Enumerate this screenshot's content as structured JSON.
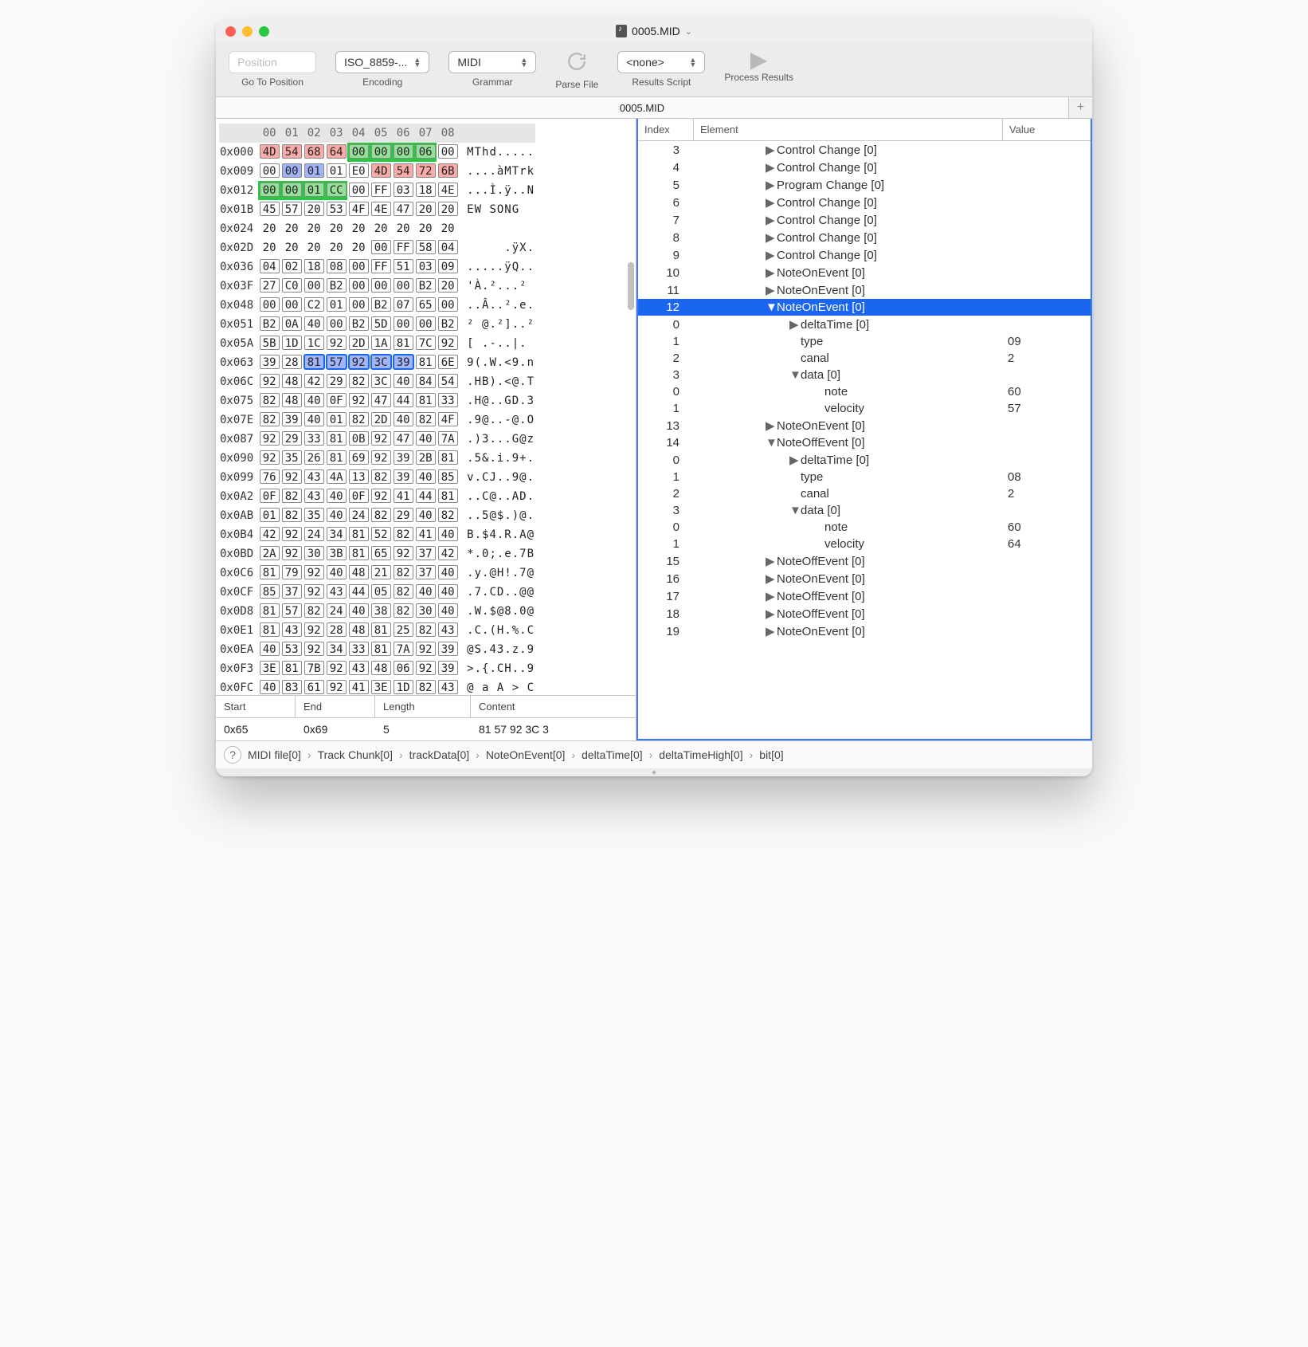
{
  "title": "0005.MID",
  "traffic": {
    "red": "close",
    "yellow": "minimize",
    "green": "zoom"
  },
  "toolbar": {
    "position": {
      "placeholder": "Position",
      "label": "Go To Position"
    },
    "encoding": {
      "value": "ISO_8859-...",
      "label": "Encoding"
    },
    "grammar": {
      "value": "MIDI",
      "label": "Grammar"
    },
    "parse": {
      "label": "Parse File"
    },
    "results": {
      "value": "<none>",
      "label": "Results Script"
    },
    "process": {
      "label": "Process Results"
    }
  },
  "tab": {
    "name": "0005.MID",
    "add": "+"
  },
  "hex": {
    "cols": [
      "00",
      "01",
      "02",
      "03",
      "04",
      "05",
      "06",
      "07",
      "08"
    ],
    "rows": [
      {
        "addr": "0x000",
        "bytes": [
          "4D",
          "54",
          "68",
          "64",
          "00",
          "00",
          "00",
          "06",
          "00"
        ],
        "ascii": "MThd.....",
        "styles": [
          "pink",
          "pink",
          "pink",
          "pink",
          "green",
          "green",
          "green",
          "green",
          "box-only"
        ]
      },
      {
        "addr": "0x009",
        "bytes": [
          "00",
          "00",
          "01",
          "01",
          "E0",
          "4D",
          "54",
          "72",
          "6B"
        ],
        "ascii": "....àMTrk",
        "styles": [
          "box-only",
          "blue",
          "blue",
          "box-only",
          "box-only",
          "pink",
          "pink",
          "pink",
          "pink"
        ]
      },
      {
        "addr": "0x012",
        "bytes": [
          "00",
          "00",
          "01",
          "CC",
          "00",
          "FF",
          "03",
          "18",
          "4E"
        ],
        "ascii": "...Ì.ÿ..N",
        "styles": [
          "green",
          "green",
          "green",
          "green",
          "box-only",
          "box-only",
          "box-only",
          "box-only",
          "box-only"
        ]
      },
      {
        "addr": "0x01B",
        "bytes": [
          "45",
          "57",
          "20",
          "53",
          "4F",
          "4E",
          "47",
          "20",
          "20"
        ],
        "ascii": "EW SONG",
        "styles": [
          "box-only",
          "box-only",
          "box-only",
          "box-only",
          "box-only",
          "box-only",
          "box-only",
          "box-only",
          "box-only"
        ]
      },
      {
        "addr": "0x024",
        "bytes": [
          "20",
          "20",
          "20",
          "20",
          "20",
          "20",
          "20",
          "20",
          "20"
        ],
        "ascii": "",
        "styles": [
          "",
          "",
          "",
          "",
          "",
          "",
          "",
          "",
          ""
        ]
      },
      {
        "addr": "0x02D",
        "bytes": [
          "20",
          "20",
          "20",
          "20",
          "20",
          "00",
          "FF",
          "58",
          "04"
        ],
        "ascii": "     .ÿX.",
        "styles": [
          "",
          "",
          "",
          "",
          "",
          "box-only",
          "box-only",
          "box-only",
          "box-only"
        ]
      },
      {
        "addr": "0x036",
        "bytes": [
          "04",
          "02",
          "18",
          "08",
          "00",
          "FF",
          "51",
          "03",
          "09"
        ],
        "ascii": ".....ÿQ..",
        "styles": [
          "box-only",
          "box-only",
          "box-only",
          "box-only",
          "box-only",
          "box-only",
          "box-only",
          "box-only",
          "box-only"
        ]
      },
      {
        "addr": "0x03F",
        "bytes": [
          "27",
          "C0",
          "00",
          "B2",
          "00",
          "00",
          "00",
          "B2",
          "20"
        ],
        "ascii": "'À.²...² ",
        "styles": [
          "box-only",
          "box-only",
          "box-only",
          "box-only",
          "box-only",
          "box-only",
          "box-only",
          "box-only",
          "box-only"
        ]
      },
      {
        "addr": "0x048",
        "bytes": [
          "00",
          "00",
          "C2",
          "01",
          "00",
          "B2",
          "07",
          "65",
          "00"
        ],
        "ascii": "..Â..².e.",
        "styles": [
          "box-only",
          "box-only",
          "box-only",
          "box-only",
          "box-only",
          "box-only",
          "box-only",
          "box-only",
          "box-only"
        ]
      },
      {
        "addr": "0x051",
        "bytes": [
          "B2",
          "0A",
          "40",
          "00",
          "B2",
          "5D",
          "00",
          "00",
          "B2"
        ],
        "ascii": "² @.²]..²",
        "styles": [
          "box-only",
          "box-only",
          "box-only",
          "box-only",
          "box-only",
          "box-only",
          "box-only",
          "box-only",
          "box-only"
        ]
      },
      {
        "addr": "0x05A",
        "bytes": [
          "5B",
          "1D",
          "1C",
          "92",
          "2D",
          "1A",
          "81",
          "7C",
          "92"
        ],
        "ascii": "[ .-..|.",
        "styles": [
          "box-only",
          "box-only",
          "box-only",
          "box-only",
          "box-only",
          "box-only",
          "box-only",
          "box-only",
          "box-only"
        ]
      },
      {
        "addr": "0x063",
        "bytes": [
          "39",
          "28",
          "81",
          "57",
          "92",
          "3C",
          "39",
          "81",
          "6E"
        ],
        "ascii": "9(.W.<9.n",
        "styles": [
          "box-only",
          "box-only",
          "sel",
          "sel",
          "sel",
          "sel",
          "sel",
          "box-only",
          "box-only"
        ]
      },
      {
        "addr": "0x06C",
        "bytes": [
          "92",
          "48",
          "42",
          "29",
          "82",
          "3C",
          "40",
          "84",
          "54"
        ],
        "ascii": ".HB).<@.T",
        "styles": [
          "box-only",
          "box-only",
          "box-only",
          "box-only",
          "box-only",
          "box-only",
          "box-only",
          "box-only",
          "box-only"
        ]
      },
      {
        "addr": "0x075",
        "bytes": [
          "82",
          "48",
          "40",
          "0F",
          "92",
          "47",
          "44",
          "81",
          "33"
        ],
        "ascii": ".H@..GD.3",
        "styles": [
          "box-only",
          "box-only",
          "box-only",
          "box-only",
          "box-only",
          "box-only",
          "box-only",
          "box-only",
          "box-only"
        ]
      },
      {
        "addr": "0x07E",
        "bytes": [
          "82",
          "39",
          "40",
          "01",
          "82",
          "2D",
          "40",
          "82",
          "4F"
        ],
        "ascii": ".9@..-@.O",
        "styles": [
          "box-only",
          "box-only",
          "box-only",
          "box-only",
          "box-only",
          "box-only",
          "box-only",
          "box-only",
          "box-only"
        ]
      },
      {
        "addr": "0x087",
        "bytes": [
          "92",
          "29",
          "33",
          "81",
          "0B",
          "92",
          "47",
          "40",
          "7A"
        ],
        "ascii": ".)3...G@z",
        "styles": [
          "box-only",
          "box-only",
          "box-only",
          "box-only",
          "box-only",
          "box-only",
          "box-only",
          "box-only",
          "box-only"
        ]
      },
      {
        "addr": "0x090",
        "bytes": [
          "92",
          "35",
          "26",
          "81",
          "69",
          "92",
          "39",
          "2B",
          "81"
        ],
        "ascii": ".5&.i.9+.",
        "styles": [
          "box-only",
          "box-only",
          "box-only",
          "box-only",
          "box-only",
          "box-only",
          "box-only",
          "box-only",
          "box-only"
        ]
      },
      {
        "addr": "0x099",
        "bytes": [
          "76",
          "92",
          "43",
          "4A",
          "13",
          "82",
          "39",
          "40",
          "85"
        ],
        "ascii": "v.CJ..9@.",
        "styles": [
          "box-only",
          "box-only",
          "box-only",
          "box-only",
          "box-only",
          "box-only",
          "box-only",
          "box-only",
          "box-only"
        ]
      },
      {
        "addr": "0x0A2",
        "bytes": [
          "0F",
          "82",
          "43",
          "40",
          "0F",
          "92",
          "41",
          "44",
          "81"
        ],
        "ascii": "..C@..AD.",
        "styles": [
          "box-only",
          "box-only",
          "box-only",
          "box-only",
          "box-only",
          "box-only",
          "box-only",
          "box-only",
          "box-only"
        ]
      },
      {
        "addr": "0x0AB",
        "bytes": [
          "01",
          "82",
          "35",
          "40",
          "24",
          "82",
          "29",
          "40",
          "82"
        ],
        "ascii": "..5@$.)@.",
        "styles": [
          "box-only",
          "box-only",
          "box-only",
          "box-only",
          "box-only",
          "box-only",
          "box-only",
          "box-only",
          "box-only"
        ]
      },
      {
        "addr": "0x0B4",
        "bytes": [
          "42",
          "92",
          "24",
          "34",
          "81",
          "52",
          "82",
          "41",
          "40"
        ],
        "ascii": "B.$4.R.A@",
        "styles": [
          "box-only",
          "box-only",
          "box-only",
          "box-only",
          "box-only",
          "box-only",
          "box-only",
          "box-only",
          "box-only"
        ]
      },
      {
        "addr": "0x0BD",
        "bytes": [
          "2A",
          "92",
          "30",
          "3B",
          "81",
          "65",
          "92",
          "37",
          "42"
        ],
        "ascii": "*.0;.e.7B",
        "styles": [
          "box-only",
          "box-only",
          "box-only",
          "box-only",
          "box-only",
          "box-only",
          "box-only",
          "box-only",
          "box-only"
        ]
      },
      {
        "addr": "0x0C6",
        "bytes": [
          "81",
          "79",
          "92",
          "40",
          "48",
          "21",
          "82",
          "37",
          "40"
        ],
        "ascii": ".y.@H!.7@",
        "styles": [
          "box-only",
          "box-only",
          "box-only",
          "box-only",
          "box-only",
          "box-only",
          "box-only",
          "box-only",
          "box-only"
        ]
      },
      {
        "addr": "0x0CF",
        "bytes": [
          "85",
          "37",
          "92",
          "43",
          "44",
          "05",
          "82",
          "40",
          "40"
        ],
        "ascii": ".7.CD..@@",
        "styles": [
          "box-only",
          "box-only",
          "box-only",
          "box-only",
          "box-only",
          "box-only",
          "box-only",
          "box-only",
          "box-only"
        ]
      },
      {
        "addr": "0x0D8",
        "bytes": [
          "81",
          "57",
          "82",
          "24",
          "40",
          "38",
          "82",
          "30",
          "40"
        ],
        "ascii": ".W.$@8.0@",
        "styles": [
          "box-only",
          "box-only",
          "box-only",
          "box-only",
          "box-only",
          "box-only",
          "box-only",
          "box-only",
          "box-only"
        ]
      },
      {
        "addr": "0x0E1",
        "bytes": [
          "81",
          "43",
          "92",
          "28",
          "48",
          "81",
          "25",
          "82",
          "43"
        ],
        "ascii": ".C.(H.%.C",
        "styles": [
          "box-only",
          "box-only",
          "box-only",
          "box-only",
          "box-only",
          "box-only",
          "box-only",
          "box-only",
          "box-only"
        ]
      },
      {
        "addr": "0x0EA",
        "bytes": [
          "40",
          "53",
          "92",
          "34",
          "33",
          "81",
          "7A",
          "92",
          "39"
        ],
        "ascii": "@S.43.z.9",
        "styles": [
          "box-only",
          "box-only",
          "box-only",
          "box-only",
          "box-only",
          "box-only",
          "box-only",
          "box-only",
          "box-only"
        ]
      },
      {
        "addr": "0x0F3",
        "bytes": [
          "3E",
          "81",
          "7B",
          "92",
          "43",
          "48",
          "06",
          "92",
          "39"
        ],
        "ascii": ">.{.CH..9",
        "styles": [
          "box-only",
          "box-only",
          "box-only",
          "box-only",
          "box-only",
          "box-only",
          "box-only",
          "box-only",
          "box-only"
        ]
      },
      {
        "addr": "0x0FC",
        "bytes": [
          "40",
          "83",
          "61",
          "92",
          "41",
          "3E",
          "1D",
          "82",
          "43"
        ],
        "ascii": "@ a A > C",
        "styles": [
          "box-only",
          "box-only",
          "box-only",
          "box-only",
          "box-only",
          "box-only",
          "box-only",
          "box-only",
          "box-only"
        ]
      }
    ],
    "info_head": {
      "start": "Start",
      "end": "End",
      "length": "Length",
      "content": "Content"
    },
    "info": {
      "start": "0x65",
      "end": "0x69",
      "length": "5",
      "content": "81 57 92 3C 3"
    }
  },
  "tree": {
    "head": {
      "index": "Index",
      "element": "Element",
      "value": "Value"
    },
    "rows": [
      {
        "idx": "3",
        "indent": 1,
        "caret": "▶",
        "label": "Control Change [0]",
        "val": ""
      },
      {
        "idx": "4",
        "indent": 1,
        "caret": "▶",
        "label": "Control Change [0]",
        "val": ""
      },
      {
        "idx": "5",
        "indent": 1,
        "caret": "▶",
        "label": "Program Change [0]",
        "val": ""
      },
      {
        "idx": "6",
        "indent": 1,
        "caret": "▶",
        "label": "Control Change [0]",
        "val": ""
      },
      {
        "idx": "7",
        "indent": 1,
        "caret": "▶",
        "label": "Control Change [0]",
        "val": ""
      },
      {
        "idx": "8",
        "indent": 1,
        "caret": "▶",
        "label": "Control Change [0]",
        "val": ""
      },
      {
        "idx": "9",
        "indent": 1,
        "caret": "▶",
        "label": "Control Change [0]",
        "val": ""
      },
      {
        "idx": "10",
        "indent": 1,
        "caret": "▶",
        "label": "NoteOnEvent [0]",
        "val": ""
      },
      {
        "idx": "11",
        "indent": 1,
        "caret": "▶",
        "label": "NoteOnEvent [0]",
        "val": ""
      },
      {
        "idx": "12",
        "indent": 1,
        "caret": "▼",
        "label": "NoteOnEvent [0]",
        "val": "",
        "sel": true
      },
      {
        "idx": "0",
        "indent": 2,
        "caret": "▶",
        "label": "deltaTime [0]",
        "val": ""
      },
      {
        "idx": "1",
        "indent": 2,
        "caret": "",
        "label": "type",
        "val": "09"
      },
      {
        "idx": "2",
        "indent": 2,
        "caret": "",
        "label": "canal",
        "val": "2"
      },
      {
        "idx": "3",
        "indent": 2,
        "caret": "▼",
        "label": "data [0]",
        "val": ""
      },
      {
        "idx": "0",
        "indent": 3,
        "caret": "",
        "label": "note",
        "val": "60"
      },
      {
        "idx": "1",
        "indent": 3,
        "caret": "",
        "label": "velocity",
        "val": "57"
      },
      {
        "idx": "13",
        "indent": 1,
        "caret": "▶",
        "label": "NoteOnEvent [0]",
        "val": ""
      },
      {
        "idx": "14",
        "indent": 1,
        "caret": "▼",
        "label": "NoteOffEvent [0]",
        "val": ""
      },
      {
        "idx": "0",
        "indent": 2,
        "caret": "▶",
        "label": "deltaTime [0]",
        "val": ""
      },
      {
        "idx": "1",
        "indent": 2,
        "caret": "",
        "label": "type",
        "val": "08"
      },
      {
        "idx": "2",
        "indent": 2,
        "caret": "",
        "label": "canal",
        "val": "2"
      },
      {
        "idx": "3",
        "indent": 2,
        "caret": "▼",
        "label": "data [0]",
        "val": ""
      },
      {
        "idx": "0",
        "indent": 3,
        "caret": "",
        "label": "note",
        "val": "60"
      },
      {
        "idx": "1",
        "indent": 3,
        "caret": "",
        "label": "velocity",
        "val": "64"
      },
      {
        "idx": "15",
        "indent": 1,
        "caret": "▶",
        "label": "NoteOffEvent [0]",
        "val": ""
      },
      {
        "idx": "16",
        "indent": 1,
        "caret": "▶",
        "label": "NoteOnEvent [0]",
        "val": ""
      },
      {
        "idx": "17",
        "indent": 1,
        "caret": "▶",
        "label": "NoteOffEvent [0]",
        "val": ""
      },
      {
        "idx": "18",
        "indent": 1,
        "caret": "▶",
        "label": "NoteOffEvent [0]",
        "val": ""
      },
      {
        "idx": "19",
        "indent": 1,
        "caret": "▶",
        "label": "NoteOnEvent [0]",
        "val": ""
      }
    ]
  },
  "path": [
    "MIDI file[0]",
    "Track Chunk[0]",
    "trackData[0]",
    "NoteOnEvent[0]",
    "deltaTime[0]",
    "deltaTimeHigh[0]",
    "bit[0]"
  ],
  "help": "?"
}
